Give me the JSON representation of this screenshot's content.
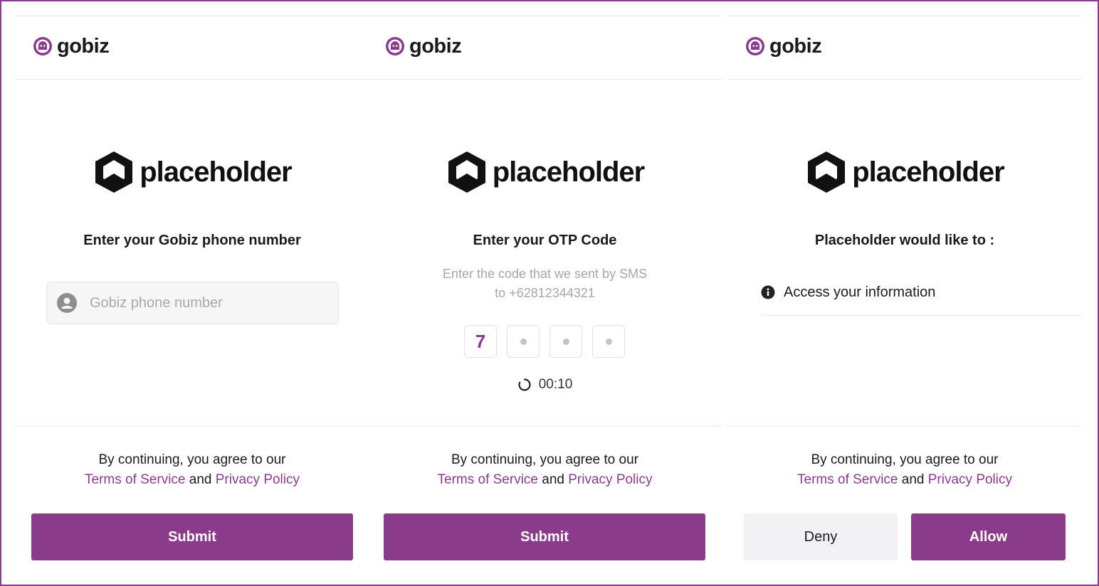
{
  "colors": {
    "brand_purple": "#8a3b8f",
    "button_purple": "#8a3b8a",
    "link_purple": "#8a3b8f",
    "secondary_button": "#f2f2f4"
  },
  "panels": [
    {
      "brand": {
        "name": "gobiz",
        "icon": "gobiz-logo-icon"
      },
      "app_logo": {
        "name": "placeholder",
        "icon": "hexagon-logo-icon"
      },
      "heading": "Enter your Gobiz phone number",
      "phone_input": {
        "placeholder": "Gobiz phone number",
        "value": "",
        "icon": "user-icon"
      },
      "consent": {
        "line1": "By continuing, you agree to our",
        "terms": "Terms of Service",
        "and": "and",
        "privacy": "Privacy Policy"
      },
      "button": "Submit"
    },
    {
      "brand": {
        "name": "gobiz",
        "icon": "gobiz-logo-icon"
      },
      "app_logo": {
        "name": "placeholder",
        "icon": "hexagon-logo-icon"
      },
      "heading": "Enter your OTP Code",
      "subtext": {
        "line1": "Enter the code that we sent by SMS",
        "line2": "to +62812344321"
      },
      "otp_digits": [
        "7",
        "",
        "",
        ""
      ],
      "timer": {
        "value": "00:10",
        "icon": "refresh-icon"
      },
      "consent": {
        "line1": "By continuing, you agree to our",
        "terms": "Terms of Service",
        "and": "and",
        "privacy": "Privacy Policy"
      },
      "button": "Submit"
    },
    {
      "brand": {
        "name": "gobiz",
        "icon": "gobiz-logo-icon"
      },
      "app_logo": {
        "name": "placeholder",
        "icon": "hexagon-logo-icon"
      },
      "heading": "Placeholder would like to :",
      "permissions": [
        {
          "label": "Access your information",
          "icon": "info-icon"
        }
      ],
      "consent": {
        "line1": "By continuing, you agree to our",
        "terms": "Terms of Service",
        "and": "and",
        "privacy": "Privacy Policy"
      },
      "deny_button": "Deny",
      "allow_button": "Allow"
    }
  ]
}
